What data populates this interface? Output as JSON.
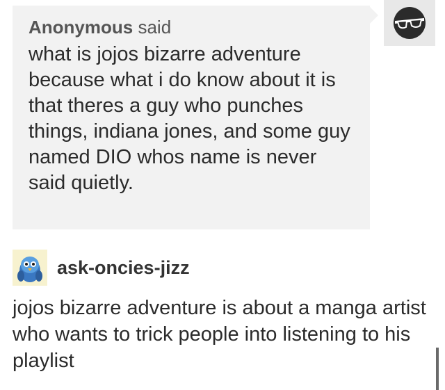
{
  "ask": {
    "asker_name": "Anonymous",
    "asker_said": "said",
    "question": "what is jojos bizarre adventure because what i do know about it is that theres a guy who punches things, indiana jones, and some guy named DIO whos name is never said quietly.",
    "avatar_icon": "sunglasses-face-icon"
  },
  "answer": {
    "answerer_name": "ask-oncies-jizz",
    "avatar_icon": "piplup-avatar-icon",
    "text": "jojos bizarre adventure is about a manga artist who wants to trick people into listening to his playlist"
  },
  "colors": {
    "bubble_bg": "#f2f2f2",
    "text": "#2b2b2b"
  }
}
